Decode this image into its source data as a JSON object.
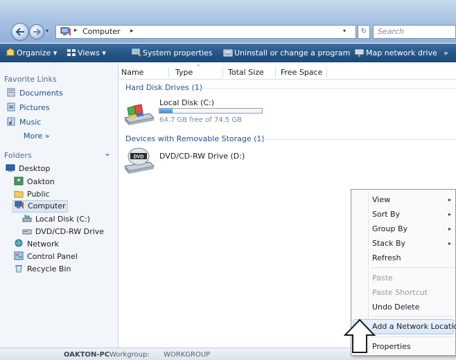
{
  "address_bar": {
    "path": "Computer",
    "separator": "▸",
    "dropdown": "▾"
  },
  "search": {
    "placeholder": "Search"
  },
  "toolbar": {
    "organize": "Organize ▾",
    "views": "Views ▾",
    "system_properties": "System properties",
    "uninstall": "Uninstall or change a program",
    "map_network_drive": "Map network drive",
    "more": "»"
  },
  "nav": {
    "favorite_links_heading": "Favorite Links",
    "favorite_links": [
      {
        "label": "Documents",
        "icon": "documents-icon"
      },
      {
        "label": "Pictures",
        "icon": "pictures-icon"
      },
      {
        "label": "Music",
        "icon": "music-icon"
      }
    ],
    "more_label": "More »",
    "folders_heading": "Folders",
    "folders_chevron": "⌄",
    "tree": [
      {
        "label": "Desktop",
        "icon": "desktop-icon"
      },
      {
        "label": "Oakton",
        "icon": "user-folder-icon"
      },
      {
        "label": "Public",
        "icon": "folder-icon"
      },
      {
        "label": "Computer",
        "icon": "computer-icon"
      },
      {
        "label": "Local Disk (C:)",
        "icon": "hard-disk-icon"
      },
      {
        "label": "DVD/CD-RW Drive",
        "icon": "dvd-drive-icon"
      },
      {
        "label": "Network",
        "icon": "network-icon"
      },
      {
        "label": "Control Panel",
        "icon": "control-panel-icon"
      },
      {
        "label": "Recycle Bin",
        "icon": "recycle-bin-icon"
      }
    ]
  },
  "columns": [
    "Name",
    "Type",
    "Total Size",
    "Free Space"
  ],
  "groups": {
    "hard_disk": {
      "header": "Hard Disk Drives (1)",
      "drive_label": "Local Disk (C:)",
      "free_text": "64.7 GB free of 74.5 GB",
      "used_fraction": 0.13
    },
    "removable": {
      "header": "Devices with Removable Storage (1)",
      "drive_label": "DVD/CD-RW Drive (D:)",
      "dvd_badge": "DVD"
    }
  },
  "context_menu": {
    "items": [
      {
        "label": "View",
        "submenu": true
      },
      {
        "label": "Sort By",
        "submenu": true
      },
      {
        "label": "Group By",
        "submenu": true
      },
      {
        "label": "Stack By",
        "submenu": true
      },
      {
        "label": "Refresh"
      },
      {
        "label": "Paste",
        "disabled": true
      },
      {
        "label": "Paste Shortcut",
        "disabled": true
      },
      {
        "label": "Undo Delete"
      },
      {
        "label": "Add a Network Location",
        "highlighted": true
      },
      {
        "label": "Properties"
      }
    ],
    "submenu_arrow": "▸"
  },
  "status_bar": {
    "computer_name": "OAKTON-PC",
    "workgroup_label": "Workgroup:",
    "workgroup": "WORKGROUP"
  },
  "colors": {
    "toolbar": "#275788",
    "accent_blue": "#1e4f9c",
    "usage_fill": "#2d8fd6"
  }
}
